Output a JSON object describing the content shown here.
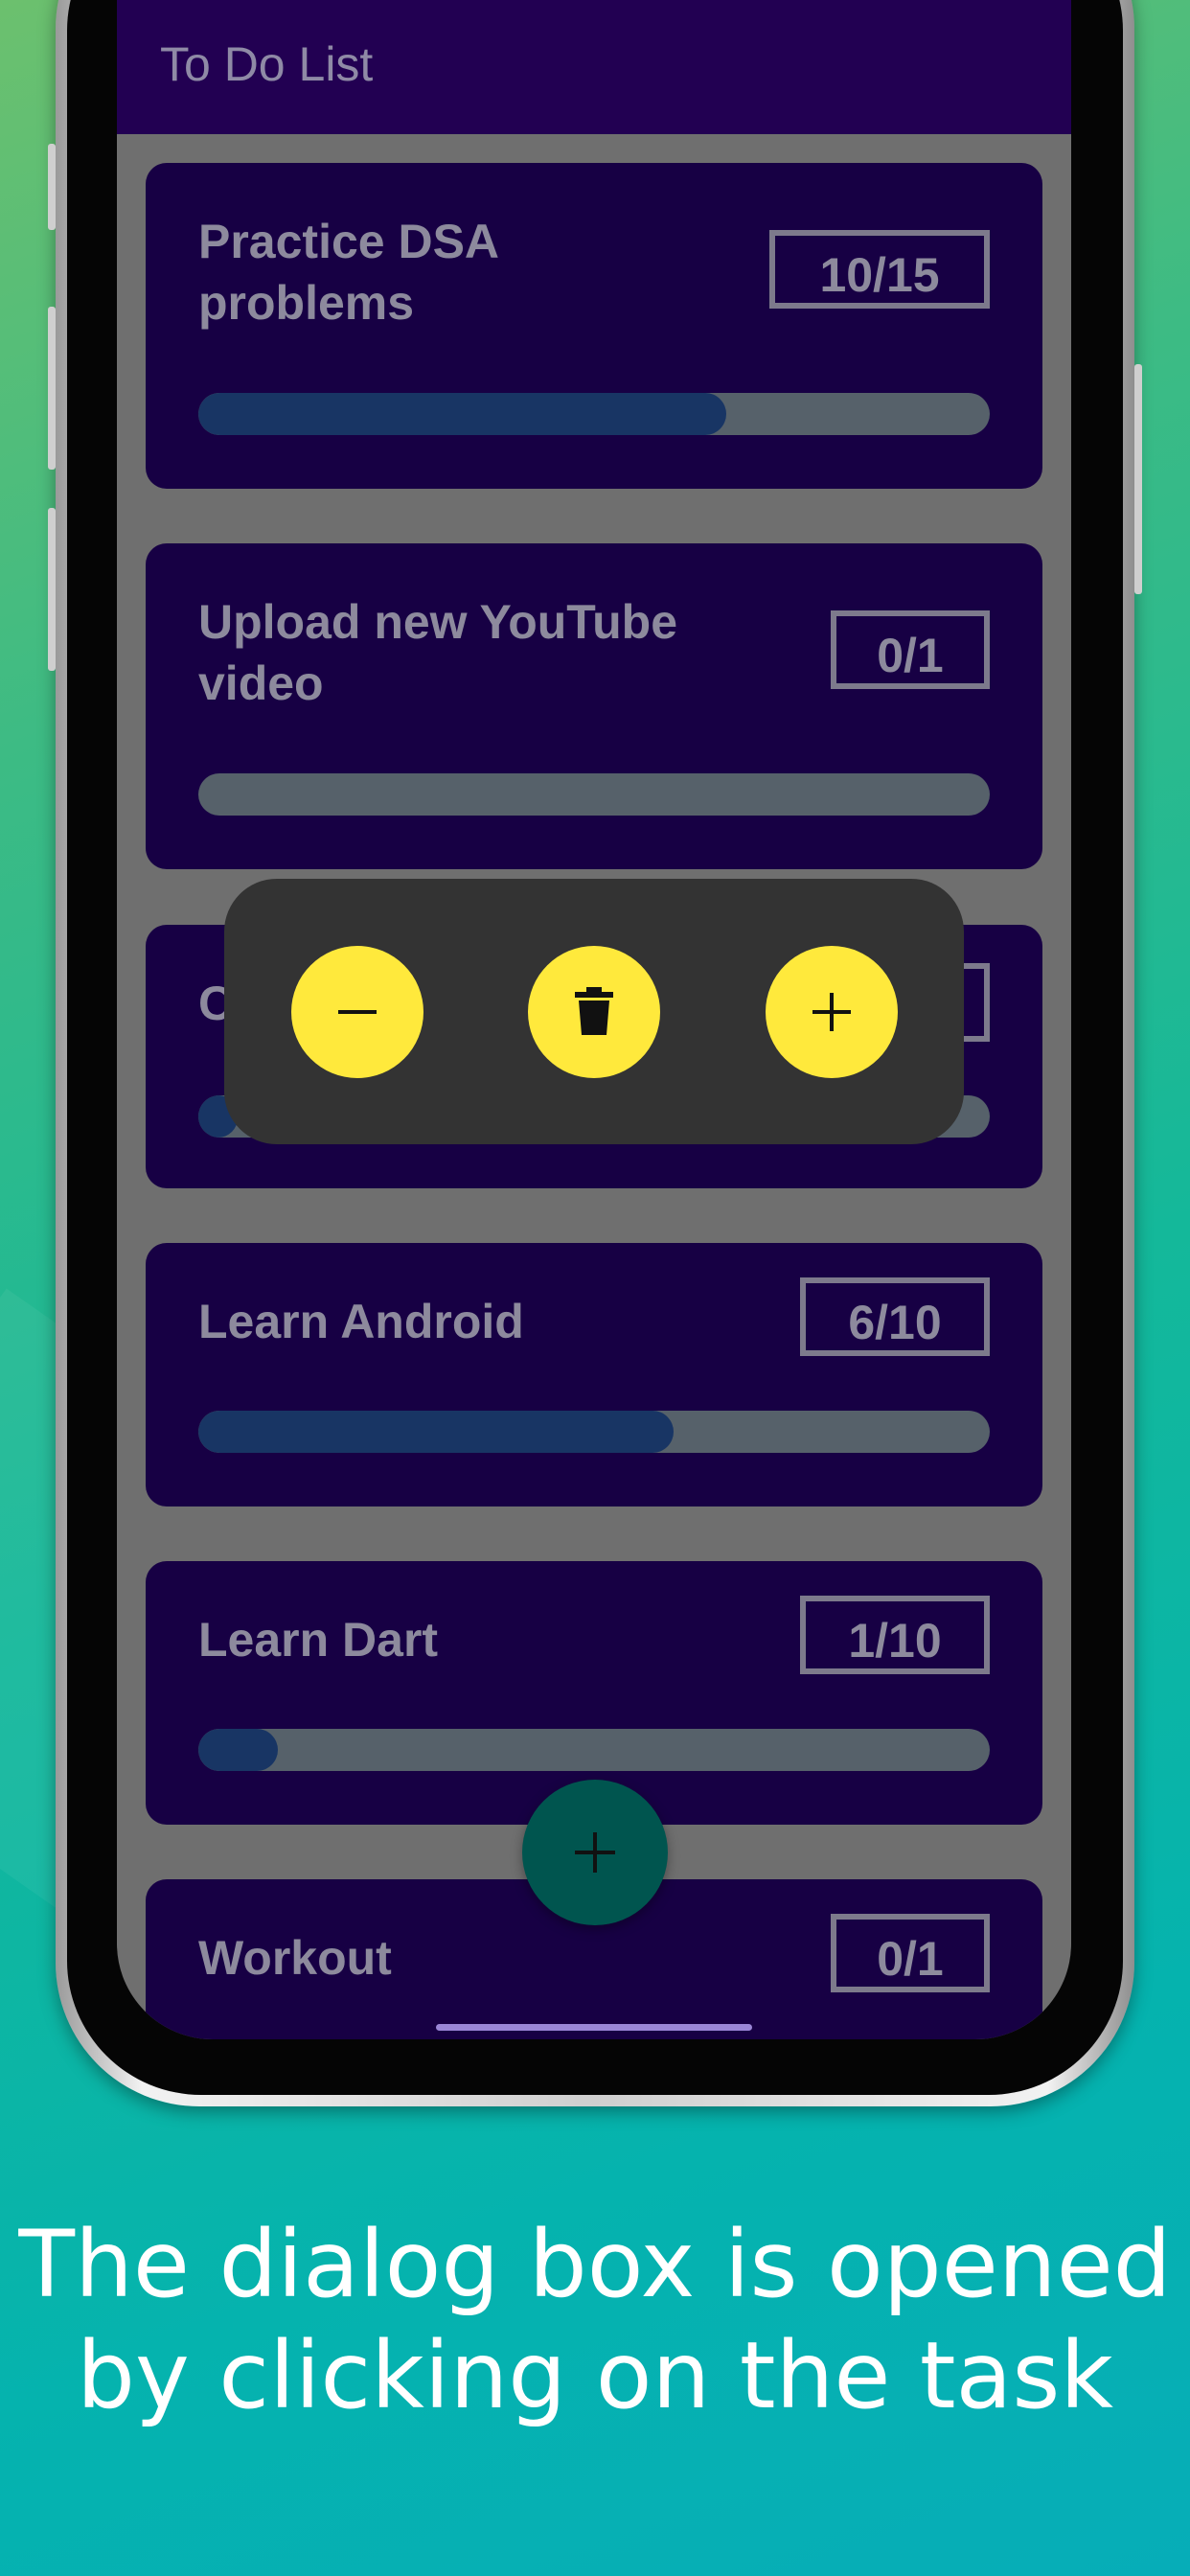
{
  "app": {
    "title": "To Do List"
  },
  "tasks": [
    {
      "title": "Practice DSA problems",
      "title_lines": [
        "Practice DSA",
        "problems"
      ],
      "count": "10/15",
      "progress": 0.667
    },
    {
      "title": "Upload new YouTube video",
      "title_lines": [
        "Upload new YouTube",
        "video"
      ],
      "count": "0/1",
      "progress": 0.0
    },
    {
      "title": "C",
      "title_lines": [
        "C"
      ],
      "count": "",
      "progress": 0.05
    },
    {
      "title": "Learn Android",
      "title_lines": [
        "Learn Android"
      ],
      "count": "6/10",
      "progress": 0.6
    },
    {
      "title": "Learn Dart",
      "title_lines": [
        "Learn Dart"
      ],
      "count": "1/10",
      "progress": 0.1
    },
    {
      "title": "Workout",
      "title_lines": [
        "Workout"
      ],
      "count": "0/1",
      "progress": 0.0
    }
  ],
  "dialog": {
    "buttons": [
      {
        "action": "decrement",
        "icon": "minus-icon"
      },
      {
        "action": "delete",
        "icon": "trash-icon"
      },
      {
        "action": "increment",
        "icon": "plus-icon"
      }
    ]
  },
  "fab": {
    "icon": "plus-icon"
  },
  "caption": {
    "line1": "The dialog box is opened",
    "line2": "by clicking on the task"
  },
  "colors": {
    "app_bar": "#220052",
    "card": "#170044",
    "progress_fill": "#183564",
    "progress_track": "#56616a",
    "dialog_bg": "#333333",
    "dialog_button": "#ffe93c",
    "fab": "#00554f"
  }
}
